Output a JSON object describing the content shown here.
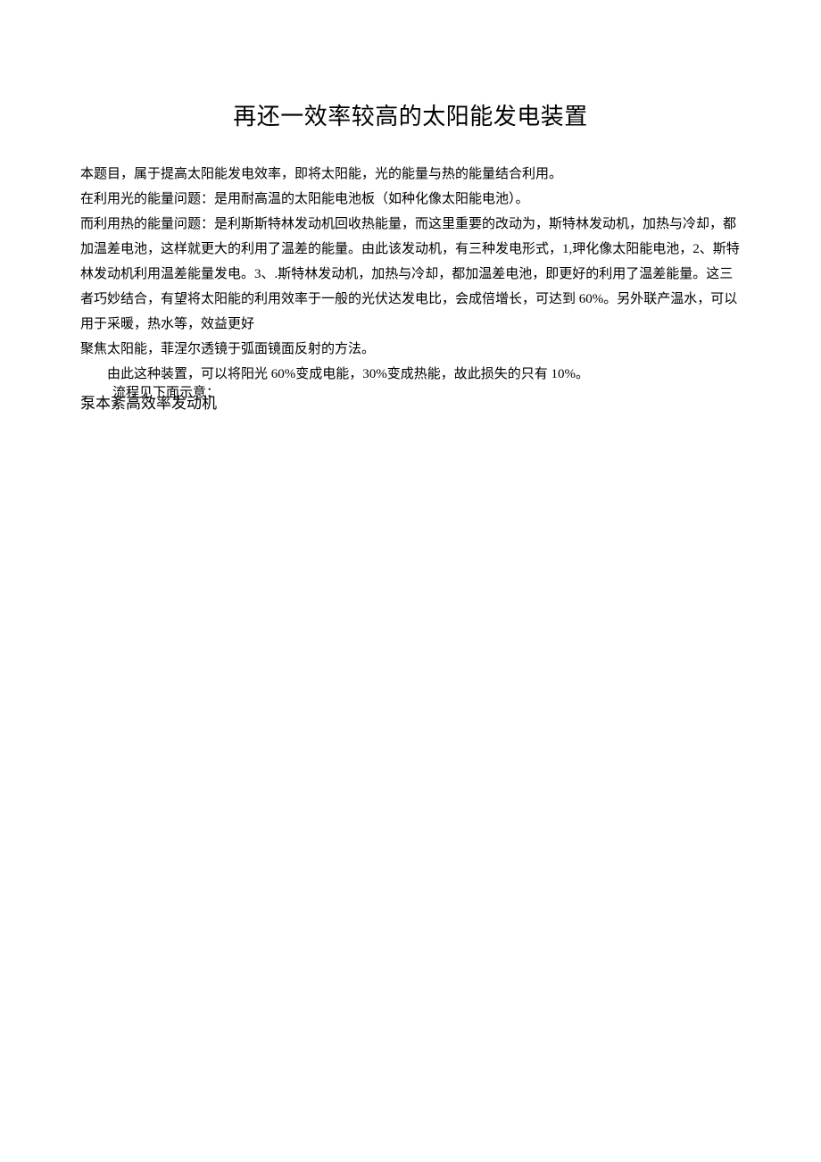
{
  "title": "再还一效率较高的太阳能发电装置",
  "p1": "本题目，属于提高太阳能发电效率，即将太阳能，光的能量与热的能量结合利用。",
  "p2": "在利用光的能量问题：是用耐高温的太阳能电池板（如种化像太阳能电池）。",
  "p3": "而利用热的能量问题：是利斯斯特林发动机回收热能量，而这里重要的改动为，斯特林发动机，加热与冷却，都加温差电池，这样就更大的利用了温差的能量。由此该发动机，有三种发电形式，1,玾化像太阳能电池，2、斯特林发动机利用温差能量发电。3、.斯特林发动机，加热与冷却，都加温差电池，即更好的利用了温差能量。这三者巧妙结合，有望将太阳能的利用效率于一般的光伏达发电比，会成倍增长，可达到 60%。另外联产温水，可以用于采暖，热水等，效益更好",
  "p4": "聚焦太阳能，菲涅尔透镜于弧面镜面反射的方法。",
  "p5": "由此这种装置，可以将阳光 60%变成电能，30%变成热能，故此损失的只有 10%。",
  "overlap_top": "流程见下面示意：",
  "overlap_bottom": "泵本紊高效率发动机"
}
